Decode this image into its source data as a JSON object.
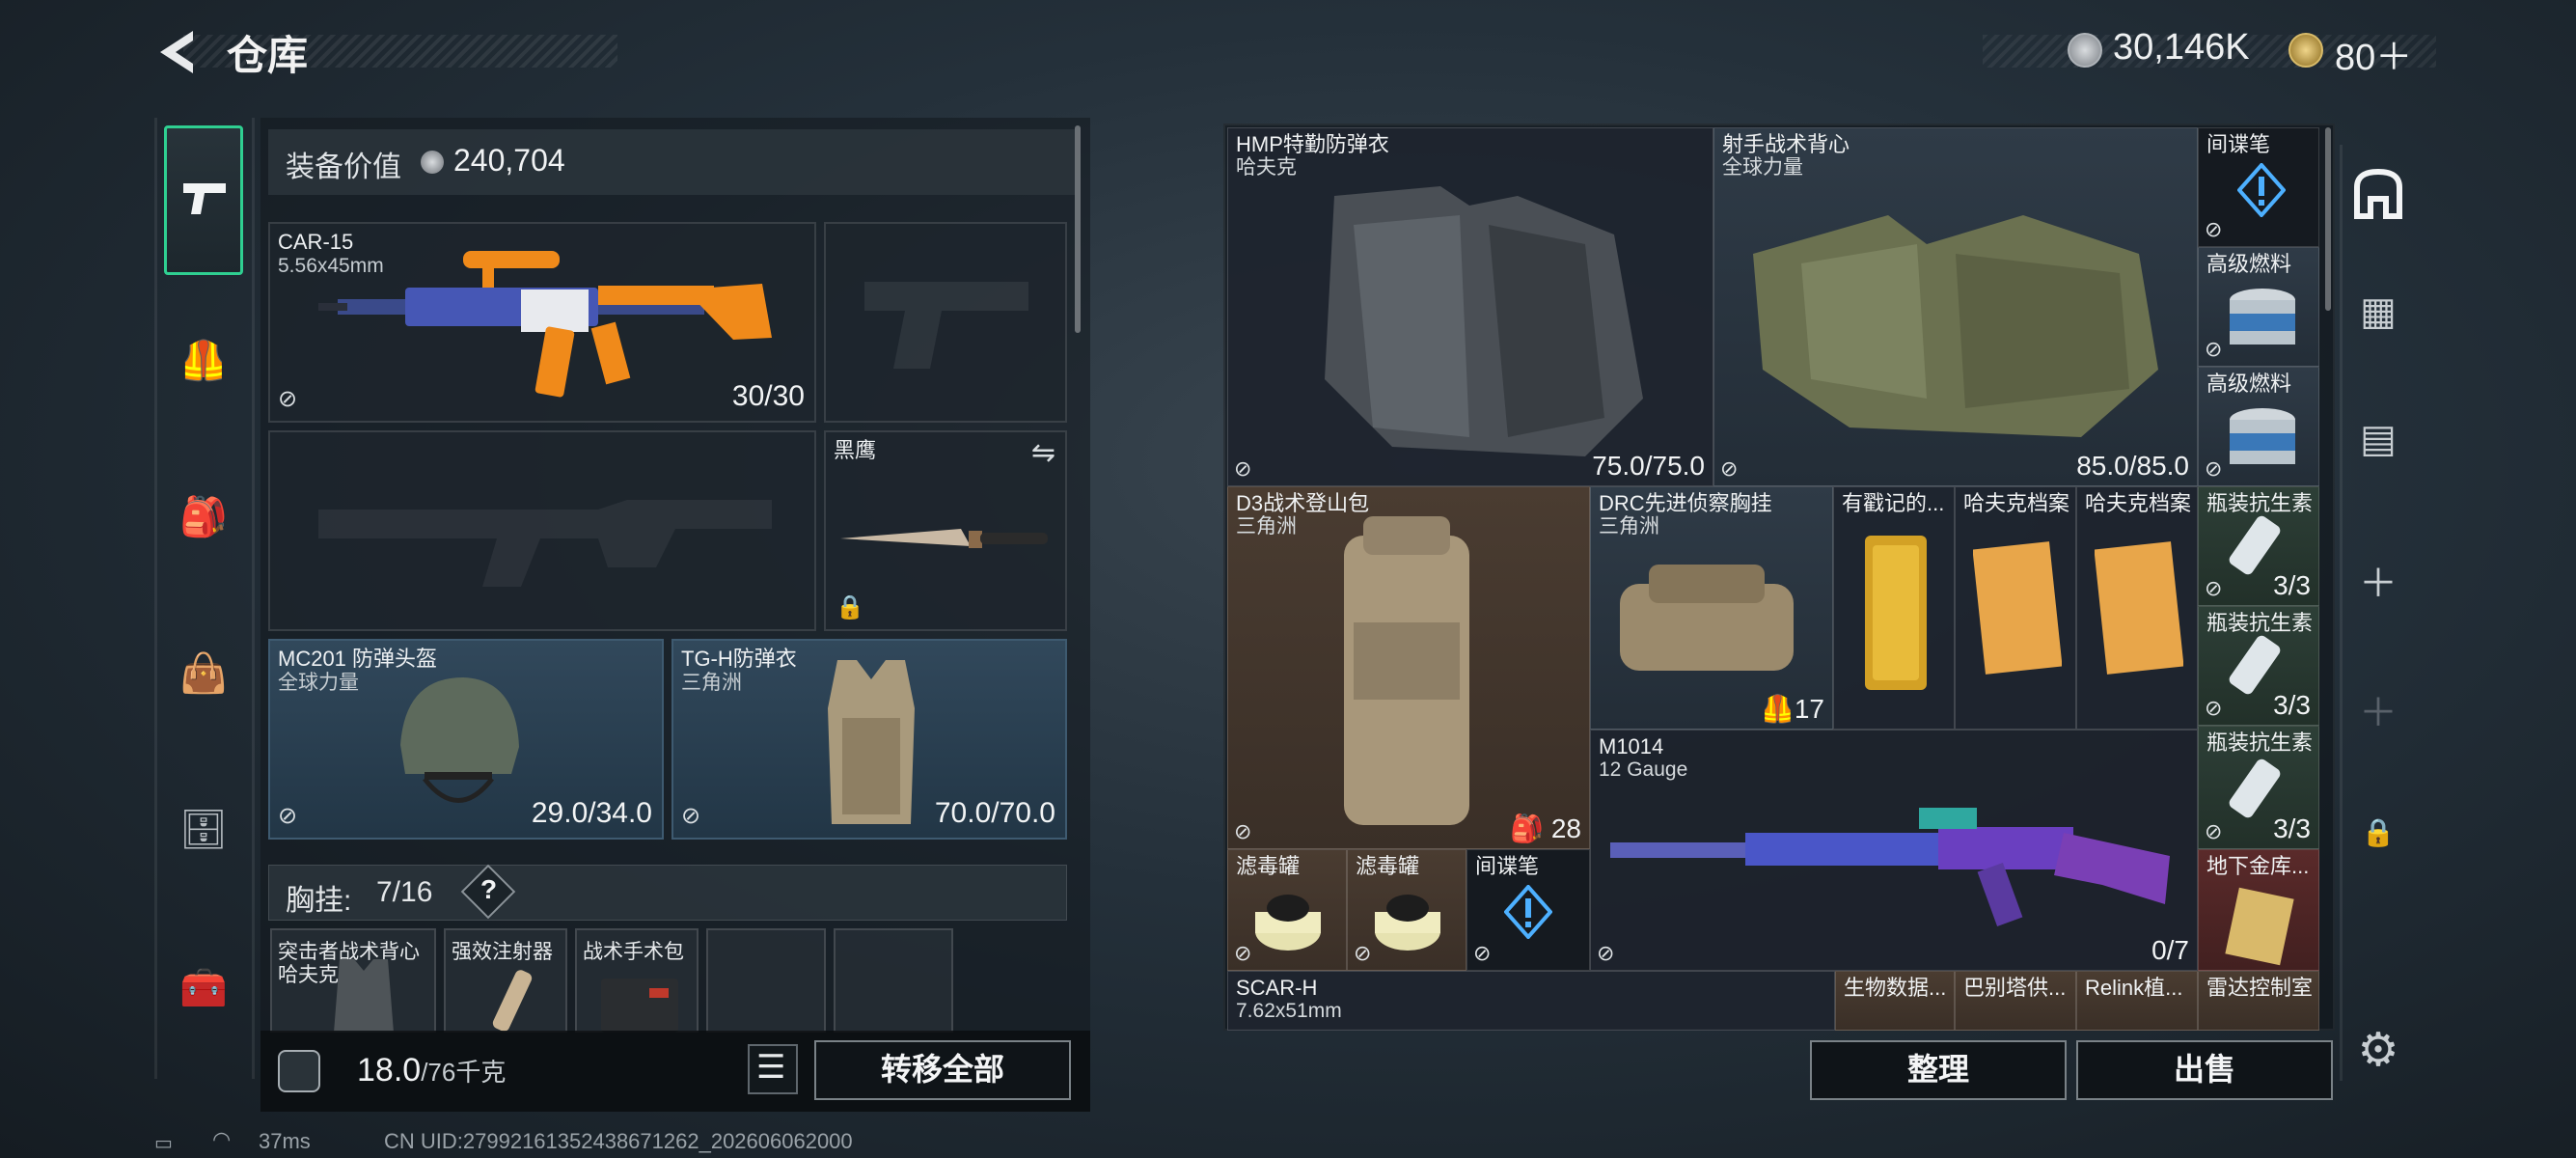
{
  "header": {
    "title": "仓库",
    "currency_a": "30,146K",
    "currency_b": "80＋"
  },
  "equipment": {
    "value_label": "装备价值",
    "value_amount": "240,704",
    "primary_weapon": {
      "name": "CAR-15",
      "sub": "5.56x45mm",
      "count": "30/30"
    },
    "melee": {
      "name": "黑鹰"
    },
    "helmet": {
      "name": "MC201 防弹头盔",
      "sub": "全球力量",
      "count": "29.0/34.0"
    },
    "armor": {
      "name": "TG-H防弹衣",
      "sub": "三角洲",
      "count": "70.0/70.0"
    },
    "chest_rig": {
      "label": "胸挂:",
      "count": "7/16",
      "help": "?"
    },
    "pockets": [
      {
        "name": "突击者战术背心",
        "sub": "哈夫克"
      },
      {
        "name": "强效注射器"
      },
      {
        "name": "战术手术包"
      }
    ]
  },
  "bottom": {
    "weight": "18.0",
    "weight_cap": "/76千克",
    "transfer_all": "转移全部",
    "organize": "整理",
    "sell": "出售"
  },
  "storage": {
    "items": [
      {
        "name": "HMP特勤防弹衣",
        "sub": "哈夫克",
        "count": "75.0/75.0"
      },
      {
        "name": "射手战术背心",
        "sub": "全球力量",
        "count": "85.0/85.0"
      },
      {
        "name": "间谍笔"
      },
      {
        "name": "高级燃料"
      },
      {
        "name": "高级燃料"
      },
      {
        "name": "D3战术登山包",
        "sub": "三角洲",
        "count": "28"
      },
      {
        "name": "DRC先进侦察胸挂",
        "sub": "三角洲",
        "count": "17"
      },
      {
        "name": "有戳记的..."
      },
      {
        "name": "哈夫克档案"
      },
      {
        "name": "哈夫克档案"
      },
      {
        "name": "瓶装抗生素",
        "count": "3/3"
      },
      {
        "name": "瓶装抗生素",
        "count": "3/3"
      },
      {
        "name": "M1014",
        "sub": "12 Gauge",
        "count": "0/7"
      },
      {
        "name": "瓶装抗生素",
        "count": "3/3"
      },
      {
        "name": "滤毒罐"
      },
      {
        "name": "滤毒罐"
      },
      {
        "name": "间谍笔"
      },
      {
        "name": "地下金库..."
      },
      {
        "name": "SCAR-H",
        "sub": "7.62x51mm"
      },
      {
        "name": "生物数据..."
      },
      {
        "name": "巴别塔供..."
      },
      {
        "name": "Relink植..."
      },
      {
        "name": "雷达控制室"
      }
    ]
  },
  "status": {
    "ping": "37ms",
    "uid": "CN UID:2799216135243867126​2_202606062000"
  }
}
